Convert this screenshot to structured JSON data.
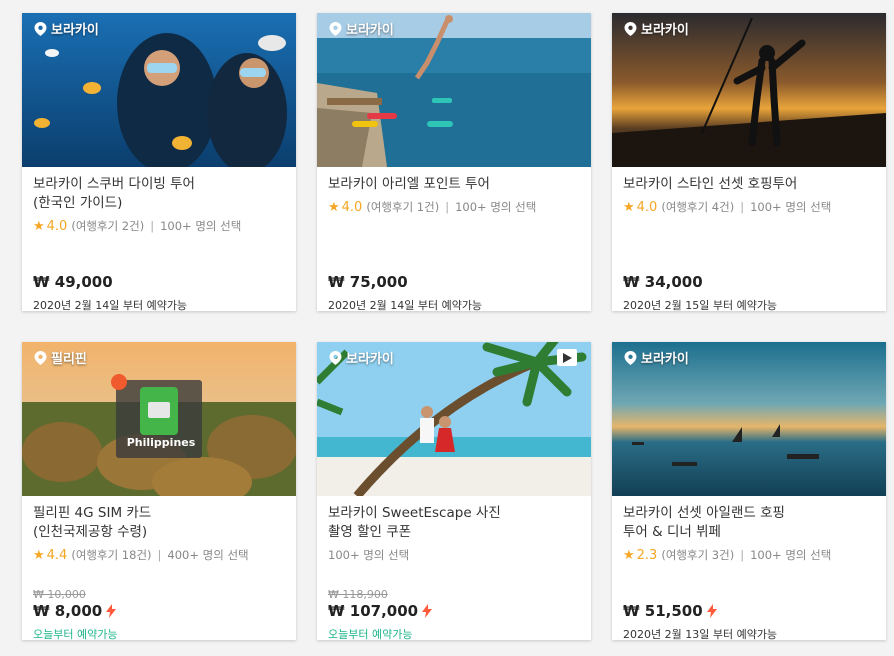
{
  "colors": {
    "accent_star": "#f5a623",
    "bolt": "#ff5a3c",
    "available_today": "#1cb58a"
  },
  "cards": [
    {
      "location": "보라카이",
      "title_line1": "보라카이 스쿠버 다이빙 투어",
      "title_line2": "(한국인 가이드)",
      "rating": "4.0",
      "reviews": "(여행후기 2건)",
      "popular": "100+ 명의 선택",
      "price": "₩ 49,000",
      "available": "2020년 2월 14일 부터 예약가능"
    },
    {
      "location": "보라카이",
      "title_line1": "보라카이 아리엘 포인트 투어",
      "rating": "4.0",
      "reviews": "(여행후기 1건)",
      "popular": "100+ 명의 선택",
      "price": "₩ 75,000",
      "available": "2020년 2월 14일 부터 예약가능"
    },
    {
      "location": "보라카이",
      "title_line1": "보라카이 스타인 선셋 호핑투어",
      "rating": "4.0",
      "reviews": "(여행후기 4건)",
      "popular": "100+ 명의 선택",
      "price": "₩ 34,000",
      "available": "2020년 2월 15일 부터 예약가능"
    },
    {
      "location": "필리핀",
      "image_text": "Philippines",
      "title_line1": "필리핀 4G SIM 카드",
      "title_line2": "(인천국제공항 수령)",
      "rating": "4.4",
      "reviews": "(여행후기 18건)",
      "popular": "400+ 명의 선택",
      "original_price": "₩ 10,000",
      "price": "₩ 8,000",
      "available": "오늘부터 예약가능"
    },
    {
      "location": "보라카이",
      "title_line1": "보라카이 SweetEscape 사진",
      "title_line2": "촬영 할인 쿠폰",
      "popular": "100+ 명의 선택",
      "original_price": "₩ 118,900",
      "price": "₩ 107,000",
      "available": "오늘부터 예약가능"
    },
    {
      "location": "보라카이",
      "title_line1": "보라카이 선셋 아일랜드 호핑",
      "title_line2": "투어 & 디너 뷔페",
      "rating": "2.3",
      "reviews": "(여행후기 3건)",
      "popular": "100+ 명의 선택",
      "price": "₩ 51,500",
      "available": "2020년 2월 13일 부터 예약가능"
    }
  ]
}
